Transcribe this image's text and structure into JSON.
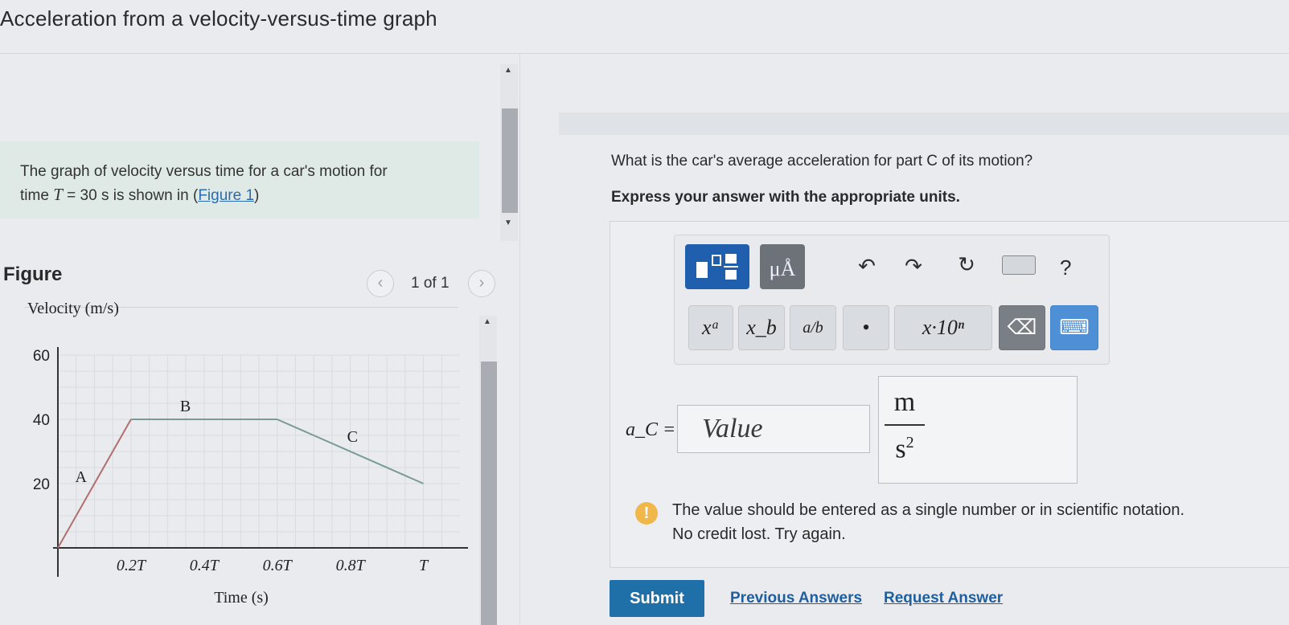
{
  "page": {
    "title": "Acceleration from a velocity-versus-time graph"
  },
  "intro": {
    "line1": "The graph of velocity versus time for a car's motion for",
    "line2_prefix": "time ",
    "line2_var": "T",
    "line2_mid": " = 30 s is shown in (",
    "figure_link": "Figure 1",
    "line2_suffix": ")"
  },
  "figure": {
    "label": "Figure",
    "counter": "1 of 1",
    "prev_glyph": "‹",
    "next_glyph": "›"
  },
  "chart_data": {
    "type": "line",
    "ylabel": "Velocity (m/s)",
    "xlabel": "Time (s)",
    "x": [
      0,
      0.2,
      0.6,
      1.0
    ],
    "x_tick_labels": [
      "0.2T",
      "0.4T",
      "0.6T",
      "0.8T",
      "T"
    ],
    "x_ticks": [
      0.2,
      0.4,
      0.6,
      0.8,
      1.0
    ],
    "y_ticks": [
      20,
      40,
      60
    ],
    "xlim": [
      0,
      1.1
    ],
    "ylim": [
      0,
      60
    ],
    "grid": true,
    "segments": [
      {
        "name": "A",
        "x": [
          0,
          0.2
        ],
        "y": [
          0,
          40
        ]
      },
      {
        "name": "B",
        "x": [
          0.2,
          0.6
        ],
        "y": [
          40,
          40
        ]
      },
      {
        "name": "C",
        "x": [
          0.6,
          1.0
        ],
        "y": [
          40,
          20
        ]
      }
    ],
    "colors": {
      "A": "#b07070",
      "B": "#7a9a9a",
      "C": "#7a9a9a"
    }
  },
  "question": {
    "text": "What is the car's average acceleration for part C of its motion?",
    "instruction": "Express your answer with the appropriate units."
  },
  "toolbar": {
    "units_label": "μÅ",
    "undo_glyph": "↶",
    "redo_glyph": "↷",
    "reset_glyph": "↻",
    "help_label": "?",
    "keys": {
      "sup": "xᵃ",
      "sub": "x_b",
      "frac": "a/b",
      "dot": "•",
      "sci": "x·10ⁿ",
      "back": "⌫",
      "kbd": "⌨"
    }
  },
  "answer": {
    "label": "a_C =",
    "placeholder": "Value",
    "unit_numerator": "m",
    "unit_denominator": "s",
    "unit_exponent": "2"
  },
  "feedback": {
    "icon": "!",
    "line1": "The value should be entered as a single number or in scientific notation.",
    "line2": "No credit lost. Try again."
  },
  "actions": {
    "submit": "Submit",
    "previous_answers": "Previous Answers",
    "request_answer": "Request Answer"
  }
}
